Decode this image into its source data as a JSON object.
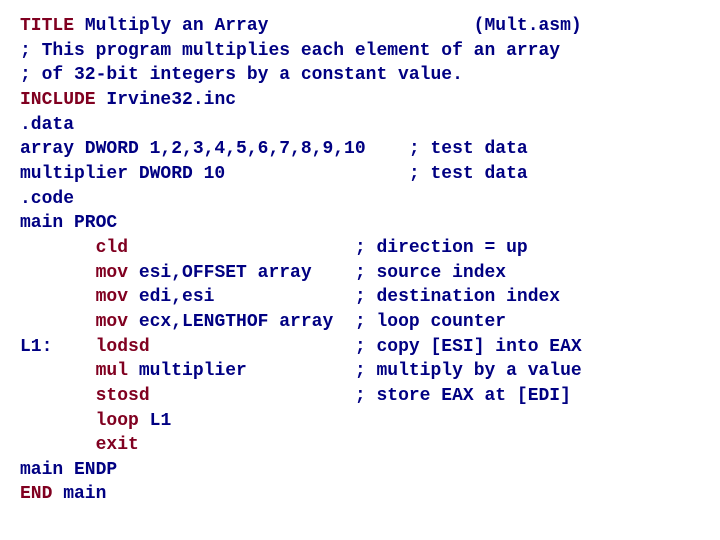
{
  "code": {
    "kw_title": "TITLE",
    "title_text": " Multiply an Array                   (Mult.asm)",
    "comment1": "; This program multiplies each element of an array",
    "comment2": "; of 32-bit integers by a constant value.",
    "kw_include": "INCLUDE",
    "include_text": " Irvine32.inc",
    "data_seg": ".data",
    "array_line": "array DWORD 1,2,3,4,5,6,7,8,9,10    ; test data",
    "mult_line": "multiplier DWORD 10                 ; test data",
    "code_seg": ".code",
    "main_proc": "main PROC",
    "i1p": "       ",
    "i1k": "cld",
    "i1o": "                     ",
    "i1c": "; direction = up",
    "i2p": "       ",
    "i2k": "mov",
    "i2o": " esi,OFFSET array    ",
    "i2c": "; source index",
    "i3p": "       ",
    "i3k": "mov",
    "i3o": " edi,esi             ",
    "i3c": "; destination index",
    "i4p": "       ",
    "i4k": "mov",
    "i4o": " ecx,LENGTHOF array  ",
    "i4c": "; loop counter",
    "i5p": "L1:    ",
    "i5k": "lodsd",
    "i5o": "                   ",
    "i5c": "; copy [ESI] into EAX",
    "i6p": "       ",
    "i6k": "mul",
    "i6o": " multiplier          ",
    "i6c": "; multiply by a value",
    "i7p": "       ",
    "i7k": "stosd",
    "i7o": "                   ",
    "i7c": "; store EAX at [EDI]",
    "i8p": "       ",
    "i8k": "loop",
    "i8o": " L1",
    "i9p": "       ",
    "i9k": "exit",
    "main_endp": "main ENDP",
    "kw_end": "END",
    "end_text": " main"
  }
}
